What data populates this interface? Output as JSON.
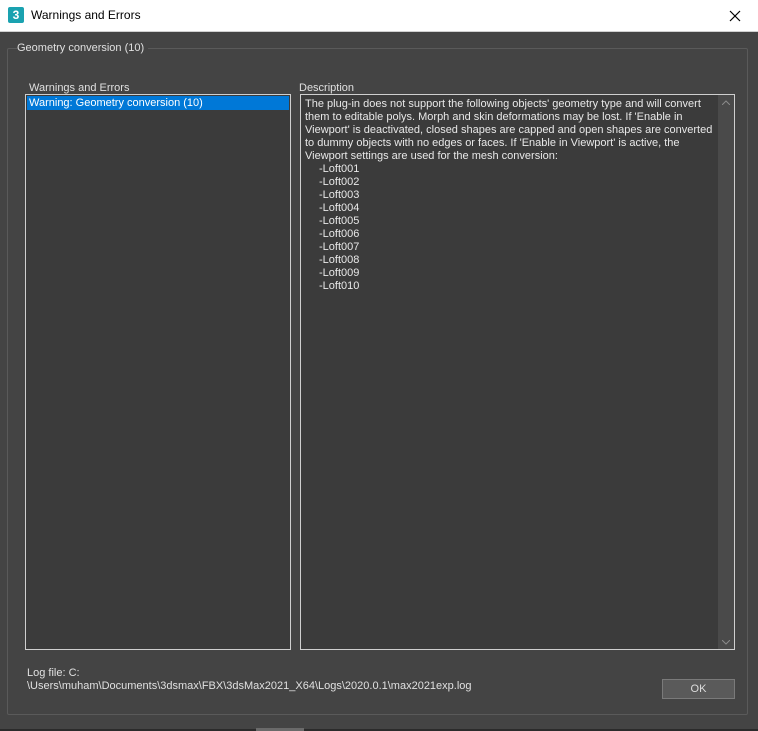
{
  "window": {
    "app_icon_glyph": "3",
    "title": "Warnings and Errors",
    "close_icon": "close-icon"
  },
  "group": {
    "title": "Geometry conversion (10)"
  },
  "warnings_list": {
    "header": "Warnings and Errors",
    "items": [
      "Warning: Geometry conversion (10)"
    ],
    "selected_index": 0
  },
  "description": {
    "header": "Description",
    "text": "The plug-in does not support the following objects' geometry type and will convert them to editable polys. Morph and skin deformations may be lost. If 'Enable in Viewport' is deactivated, closed shapes are capped and open shapes are converted to dummy objects with no edges or faces. If 'Enable in Viewport' is active, the Viewport settings are used for the mesh conversion:",
    "objects": [
      "-Loft001",
      "-Loft002",
      "-Loft003",
      "-Loft004",
      "-Loft005",
      "-Loft006",
      "-Loft007",
      "-Loft008",
      "-Loft009",
      "-Loft010"
    ]
  },
  "log": {
    "line1": "Log file: C:",
    "line2": "\\Users\\muham\\Documents\\3dsmax\\FBX\\3dsMax2021_X64\\Logs\\2020.0.1\\max2021exp.log"
  },
  "buttons": {
    "ok_label": "OK"
  },
  "colors": {
    "background": "#444444",
    "selection": "#0078d7",
    "app_icon": "#1aa2b0"
  }
}
